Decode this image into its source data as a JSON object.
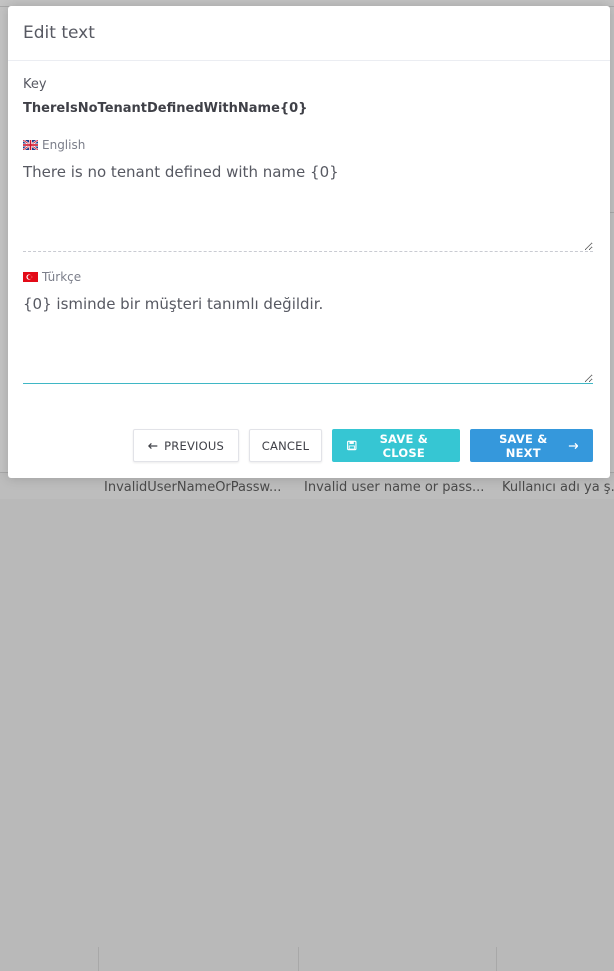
{
  "background": {
    "grid_cells": [
      "InvalidUserNameOrPassw...",
      "Invalid user name or pass...",
      "Kullanıcı adı ya ş..."
    ]
  },
  "modal": {
    "title": "Edit text",
    "key_label": "Key",
    "key_value": "ThereIsNoTenantDefinedWithName{0}",
    "source_language": {
      "name": "English",
      "flag": "uk-flag-icon",
      "value": "There is no tenant defined with name {0}"
    },
    "target_language": {
      "name": "Türkçe",
      "flag": "turkey-flag-icon",
      "value": "{0} isminde bir müşteri tanımlı değildir."
    },
    "buttons": {
      "previous": "PREVIOUS",
      "cancel": "CANCEL",
      "save_close": "SAVE & CLOSE",
      "save_next": "SAVE & NEXT"
    }
  },
  "colors": {
    "save_close": "#36c6d3",
    "save_next": "#3598dc",
    "active_border": "#3fb7c5"
  }
}
